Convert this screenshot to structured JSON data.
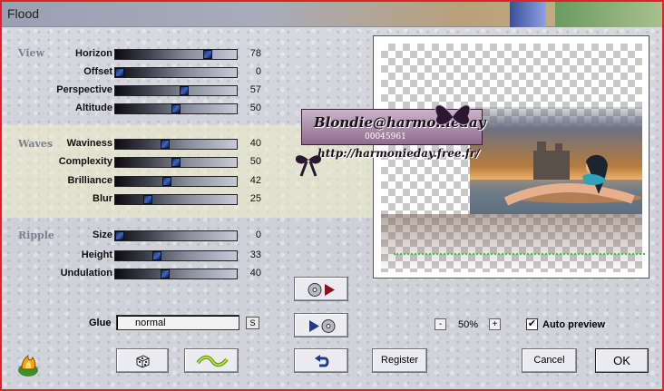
{
  "window": {
    "title": "Flood"
  },
  "sections": {
    "view": "View",
    "waves": "Waves",
    "ripple": "Ripple"
  },
  "params": [
    {
      "label": "Horizon",
      "value": "78",
      "level": 78
    },
    {
      "label": "Offset",
      "value": "0",
      "level": 0
    },
    {
      "label": "Perspective",
      "value": "57",
      "level": 57
    },
    {
      "label": "Altitude",
      "value": "50",
      "level": 50
    },
    {
      "label": "Waviness",
      "value": "40",
      "level": 40
    },
    {
      "label": "Complexity",
      "value": "50",
      "level": 50
    },
    {
      "label": "Brilliance",
      "value": "42",
      "level": 42
    },
    {
      "label": "Blur",
      "value": "25",
      "level": 25
    },
    {
      "label": "Size",
      "value": "0",
      "level": 0
    },
    {
      "label": "Height",
      "value": "33",
      "level": 33
    },
    {
      "label": "Undulation",
      "value": "40",
      "level": 40
    }
  ],
  "glue": {
    "label": "Glue",
    "value": "normal",
    "small_button": "S"
  },
  "preview": {
    "zoom_minus": "-",
    "zoom": "50%",
    "zoom_plus": "+",
    "auto_preview_label": "Auto preview",
    "auto_preview_checked": true,
    "watermark_lines": [
      "Blondie@harmonieday",
      "00045961",
      "http://harmonieday.free.fr/"
    ]
  },
  "buttons": {
    "register": "Register",
    "cancel": "Cancel",
    "ok": "OK"
  },
  "colors": {
    "frame": "#e0202a",
    "slider_thumb": "#2f56b0",
    "section_label": "#7b7f90",
    "waterline": "#2ecc40"
  },
  "icons": {
    "app": "flame-logo-icon",
    "randomize": "dice-icon",
    "wave": "wave-icon",
    "reset": "undo-icon",
    "load_preset": "disc-arrow-right-icon",
    "save_preset": "arrow-disc-icon"
  }
}
